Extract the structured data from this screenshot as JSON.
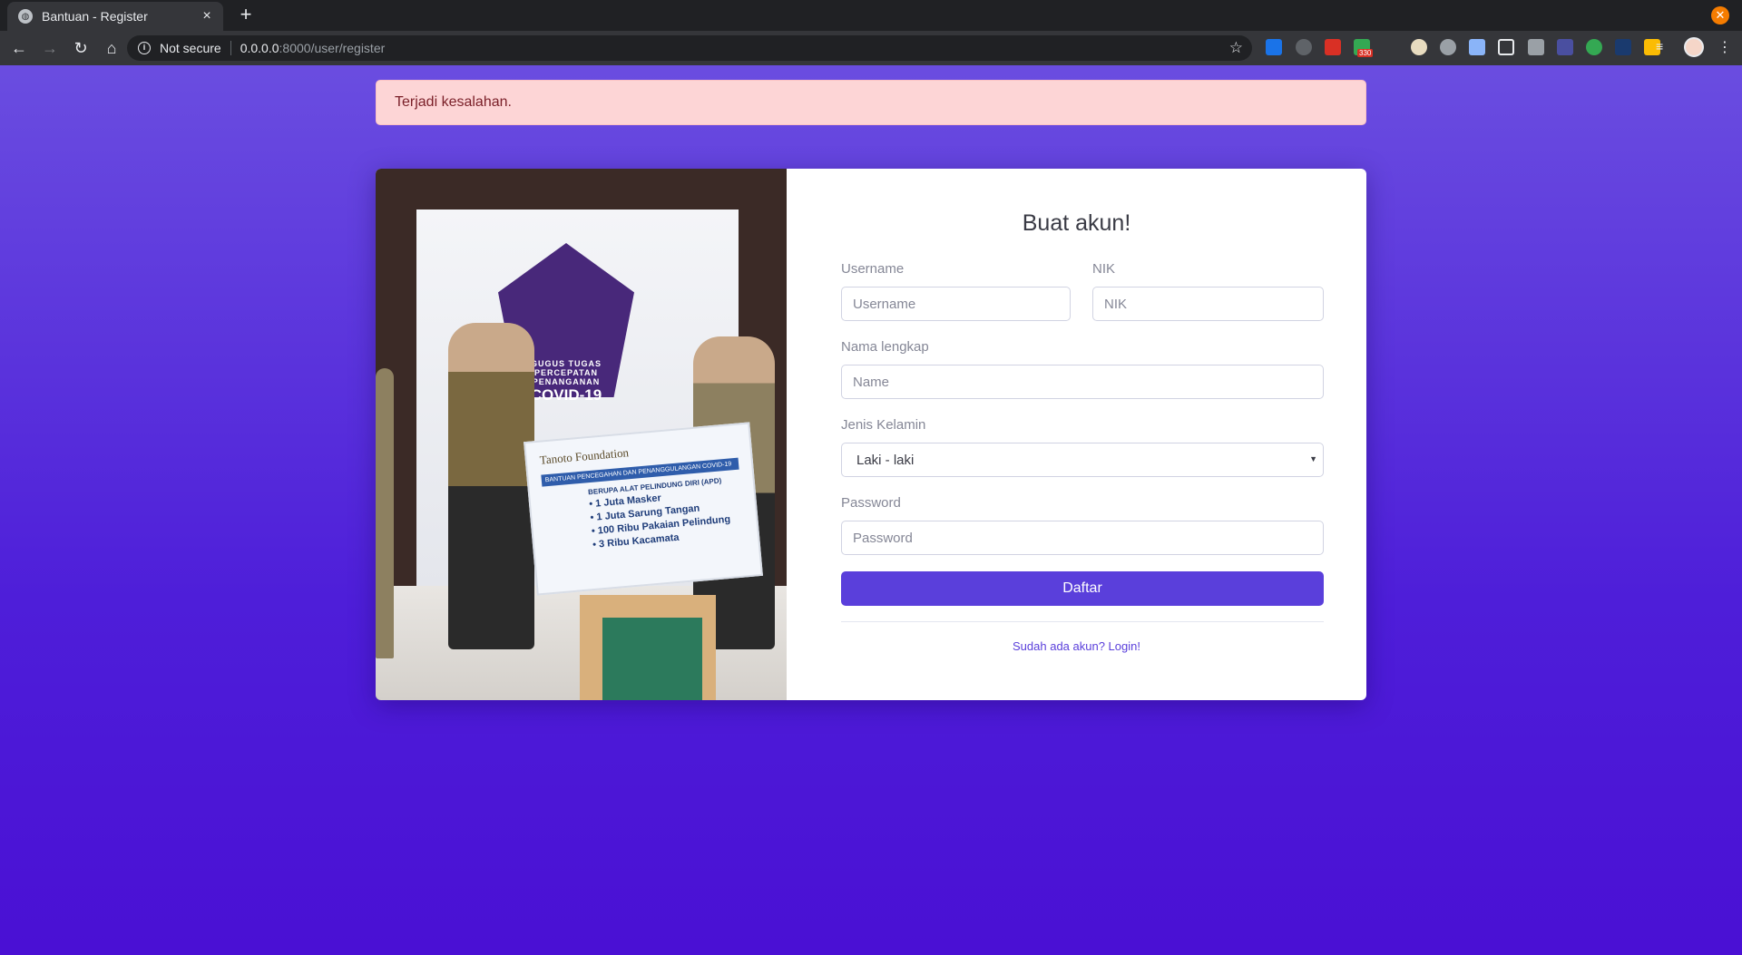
{
  "browser": {
    "tab_title": "Bantuan - Register",
    "tab_close": "×",
    "new_tab": "+",
    "security": "Not secure",
    "url_host": "0.0.0.0",
    "url_path": ":8000/user/register",
    "window_close": "✕",
    "extension_badge": "330"
  },
  "alert": {
    "message": "Terjadi kesalahan.",
    "color": "#fdd5d6"
  },
  "form": {
    "title": "Buat akun!",
    "username_label": "Username",
    "username_placeholder": "Username",
    "nik_label": "NIK",
    "nik_placeholder": "NIK",
    "name_label": "Nama lengkap",
    "name_placeholder": "Name",
    "gender_label": "Jenis Kelamin",
    "gender_value": "Laki - laki",
    "password_label": "Password",
    "password_placeholder": "Password",
    "submit": "Daftar",
    "login_link": "Sudah ada akun? Login!"
  },
  "photo": {
    "pentagon_title": "GUGUS TUGAS PERCEPATAN PENANGANAN",
    "pentagon_main": "COVID-19",
    "sign_brand": "Tanoto Foundation",
    "sign_strip": "BANTUAN PENCEGAHAN DAN PENANGGULANGAN COVID-19",
    "sign_heading": "BERUPA ALAT PELINDUNG DIRI (APD)",
    "sign_lines": [
      "• 1 Juta Masker",
      "• 1 Juta Sarung Tangan",
      "• 100 Ribu Pakaian Pelindung",
      "• 3 Ribu Kacamata"
    ]
  },
  "colors": {
    "primary": "#5a3fdb",
    "background": "#4e1ed9"
  }
}
